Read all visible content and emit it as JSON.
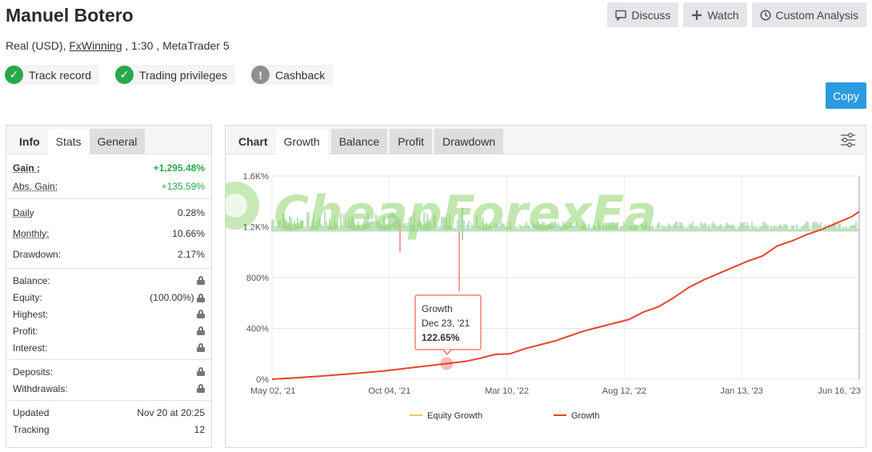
{
  "header": {
    "name": "Manuel Botero",
    "account_type": "Real (USD), ",
    "broker_link": "FxWinning",
    "account_rest": " , 1:30 , MetaTrader 5"
  },
  "actions": {
    "discuss": "Discuss",
    "watch": "Watch",
    "custom_analysis": "Custom Analysis",
    "copy": "Copy"
  },
  "badges": [
    {
      "label": "Track record",
      "status": "verified"
    },
    {
      "label": "Trading privileges",
      "status": "verified"
    },
    {
      "label": "Cashback",
      "status": "info"
    }
  ],
  "left_tabs": {
    "info": "Info",
    "stats": "Stats",
    "general": "General"
  },
  "stats": {
    "gain_label": "Gain :",
    "gain_value": "+1,295.48%",
    "abs_gain_label": "Abs. Gain:",
    "abs_gain_value": "+135.59%",
    "daily_label": "Daily",
    "daily_value": "0.28%",
    "monthly_label": "Monthly:",
    "monthly_value": "10.66%",
    "drawdown_label": "Drawdown:",
    "drawdown_value": "2.17%",
    "balance_label": "Balance:",
    "equity_label": "Equity:",
    "equity_value": "(100.00%)",
    "highest_label": "Highest:",
    "profit_label": "Profit:",
    "interest_label": "Interest:",
    "deposits_label": "Deposits:",
    "withdrawals_label": "Withdrawals:",
    "updated_label": "Updated",
    "updated_value": "Nov 20 at 20:25",
    "tracking_label": "Tracking",
    "tracking_value": "12"
  },
  "chart_tabs": {
    "chart": "Chart",
    "growth": "Growth",
    "balance": "Balance",
    "profit": "Profit",
    "drawdown": "Drawdown"
  },
  "watermark": "CheapForexEa",
  "tooltip": {
    "title": "Growth",
    "date": "Dec 23, '21",
    "value": "122.65%"
  },
  "colors": {
    "growth": "#e8432f",
    "equity": "#f2c94c",
    "bars": "#7bc67b",
    "accent": "#2b9be0",
    "positive": "#2aa84a"
  },
  "chart_data": {
    "type": "line",
    "ylabel": "",
    "yticks": [
      "0%",
      "400%",
      "800%",
      "1.2K%",
      "1.6K%"
    ],
    "ylim": [
      0,
      1600
    ],
    "xticks": [
      "May 02, '21",
      "Oct 04, '21",
      "Mar 10, '22",
      "Aug 12, '22",
      "Jan 13, '23",
      "Jun 16, '23"
    ],
    "x_range_days": [
      0,
      790
    ],
    "series": [
      {
        "name": "Equity Growth",
        "color": "#f2c94c",
        "points": []
      },
      {
        "name": "Growth",
        "color": "#e8432f",
        "points": [
          [
            0,
            0
          ],
          [
            30,
            10
          ],
          [
            60,
            22
          ],
          [
            90,
            35
          ],
          [
            120,
            50
          ],
          [
            150,
            65
          ],
          [
            180,
            85
          ],
          [
            210,
            105
          ],
          [
            235,
            122.65
          ],
          [
            260,
            140
          ],
          [
            280,
            165
          ],
          [
            300,
            195
          ],
          [
            320,
            200
          ],
          [
            340,
            240
          ],
          [
            360,
            270
          ],
          [
            380,
            300
          ],
          [
            400,
            340
          ],
          [
            420,
            380
          ],
          [
            440,
            410
          ],
          [
            460,
            440
          ],
          [
            480,
            470
          ],
          [
            500,
            530
          ],
          [
            520,
            570
          ],
          [
            540,
            640
          ],
          [
            560,
            720
          ],
          [
            580,
            780
          ],
          [
            600,
            830
          ],
          [
            620,
            880
          ],
          [
            640,
            930
          ],
          [
            660,
            970
          ],
          [
            680,
            1050
          ],
          [
            700,
            1090
          ],
          [
            720,
            1140
          ],
          [
            740,
            1180
          ],
          [
            760,
            1230
          ],
          [
            780,
            1280
          ],
          [
            790,
            1320
          ]
        ]
      }
    ],
    "legend": "bottom-center"
  }
}
